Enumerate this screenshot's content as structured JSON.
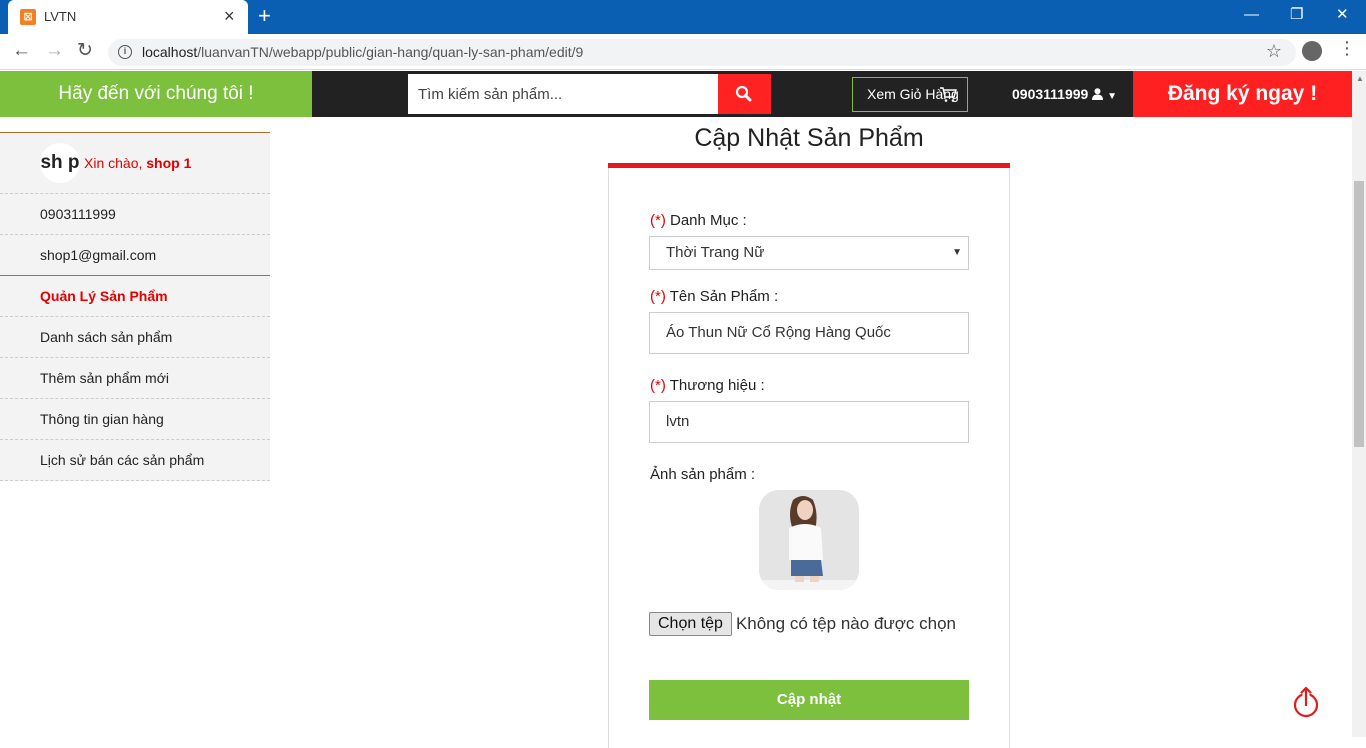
{
  "browser": {
    "tab_title": "LVTN",
    "tab_favicon": "xampp",
    "url_host": "localhost",
    "url_path": "/luanvanTN/webapp/public/gian-hang/quan-ly-san-pham/edit/9"
  },
  "header": {
    "welcome": "Hãy đến với chúng tôi !",
    "search_placeholder": "Tìm kiếm sản phẩm...",
    "cart_label": "Xem Giỏ Hàng",
    "phone": "0903111999",
    "register": "Đăng ký ngay !"
  },
  "sidebar": {
    "avatar_text": "sh p",
    "greeting": "Xin chào, ",
    "shop_name": "shop 1",
    "phone": "0903111999",
    "email": "shop1@gmail.com",
    "section_heading": "Quản Lý Sản Phẩm",
    "items": [
      {
        "label": "Danh sách sản phẩm"
      },
      {
        "label": "Thêm sản phẩm mới"
      },
      {
        "label": "Thông tin gian hàng"
      },
      {
        "label": "Lịch sử bán các sản phẩm"
      }
    ]
  },
  "form": {
    "title": "Cập Nhật Sản Phẩm",
    "required_mark": "(*)",
    "category_label": "Danh Mục :",
    "category_value": "Thời Trang Nữ",
    "name_label": "Tên Sản Phẩm :",
    "name_value": "Áo Thun Nữ Cổ Rộng Hàng Quốc",
    "brand_label": "Thương hiệu :",
    "brand_value": "lvtn",
    "image_label": "Ảnh sản phẩm :",
    "file_button": "Chọn tệp",
    "file_status": "Không có tệp nào được chọn",
    "submit": "Cập nhật"
  },
  "colors": {
    "green": "#7dc03d",
    "red": "#ff2121",
    "dark": "#222222",
    "chrome_blue": "#0b5fb3"
  }
}
